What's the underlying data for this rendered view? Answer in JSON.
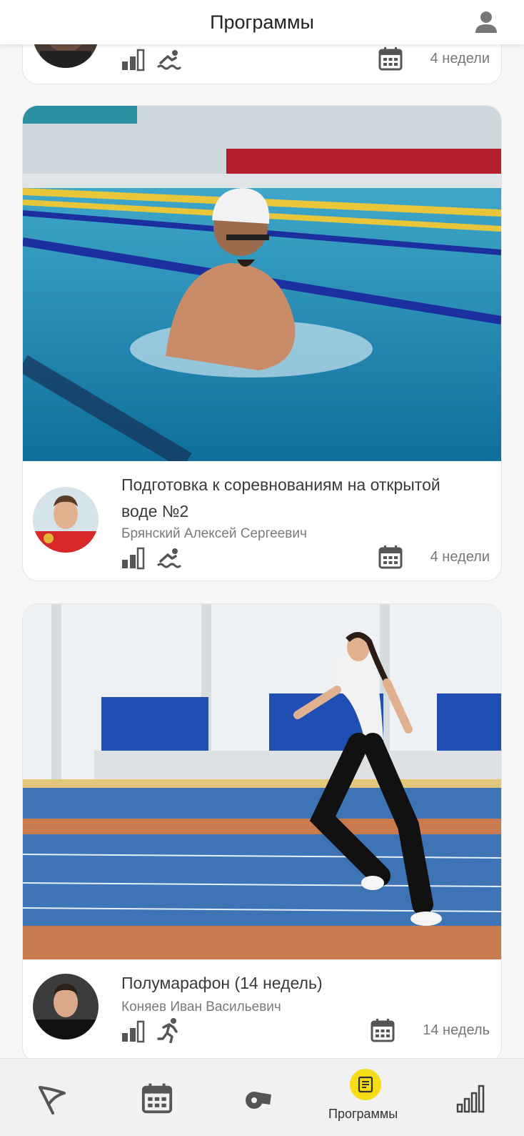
{
  "header": {
    "title": "Программы",
    "profile_icon": "person-icon"
  },
  "programs": [
    {
      "duration": "4 недели",
      "sport_icon": "swimming-icon",
      "level_icon": "level-bars-icon"
    },
    {
      "title": "Подготовка к соревнованиям на открытой воде №2",
      "author": "Брянский Алексей Сергеевич",
      "duration": "4 недели",
      "sport_icon": "swimming-icon",
      "level_icon": "level-bars-icon"
    },
    {
      "title": "Полумарафон (14 недель)",
      "author": "Коняев Иван Васильевич",
      "duration": "14 недель",
      "sport_icon": "running-icon",
      "level_icon": "level-bars-icon"
    }
  ],
  "nav": {
    "items": [
      {
        "icon": "flag-icon"
      },
      {
        "icon": "calendar-icon"
      },
      {
        "icon": "whistle-icon"
      },
      {
        "icon": "programs-icon",
        "label": "Программы",
        "active": true
      },
      {
        "icon": "stats-icon"
      }
    ]
  },
  "colors": {
    "accent": "#f6dc16",
    "icon": "#555555",
    "background": "#f7f7f7"
  }
}
